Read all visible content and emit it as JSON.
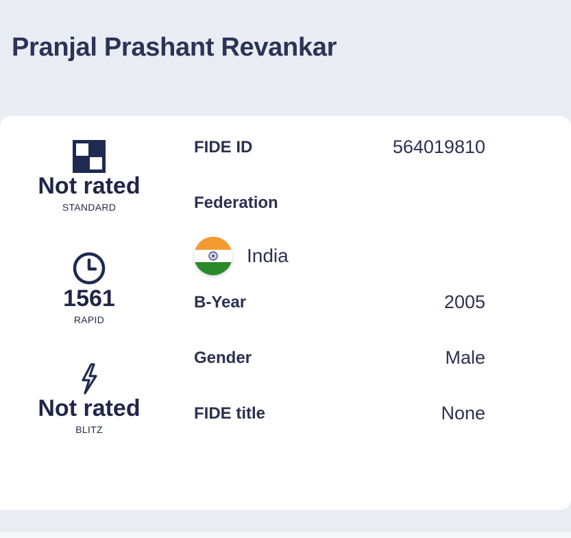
{
  "player": {
    "name": "Pranjal Prashant Revankar"
  },
  "ratings": {
    "standard": {
      "value": "Not rated",
      "label": "STANDARD",
      "icon": "chessboard-icon"
    },
    "rapid": {
      "value": "1561",
      "label": "RAPID",
      "icon": "clock-icon"
    },
    "blitz": {
      "value": "Not rated",
      "label": "BLITZ",
      "icon": "lightning-icon"
    }
  },
  "info": {
    "fide_id": {
      "label": "FIDE ID",
      "value": "564019810"
    },
    "federation": {
      "label": "Federation",
      "country": "India",
      "icon": "india-flag-icon"
    },
    "byear": {
      "label": "B-Year",
      "value": "2005"
    },
    "gender": {
      "label": "Gender",
      "value": "Male"
    },
    "title": {
      "label": "FIDE title",
      "value": "None"
    }
  },
  "colors": {
    "background": "#e9ecf2",
    "card": "#ffffff",
    "text": "#2a3150",
    "icon": "#1f2a50",
    "flag_saffron": "#f39a30",
    "flag_green": "#2a8a2a",
    "flag_chakra": "#1a237e"
  }
}
